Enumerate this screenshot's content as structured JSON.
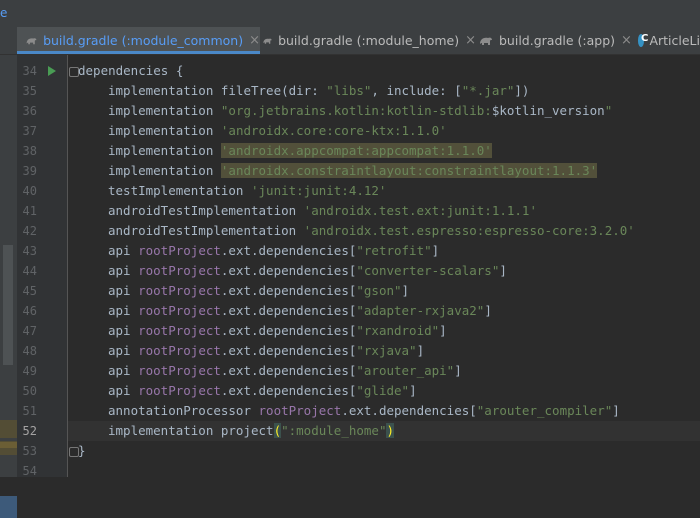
{
  "top_fragment": "e",
  "tabs": [
    {
      "label": "build.gradle (:module_common)",
      "active": true,
      "icon": "gradle-icon"
    },
    {
      "label": "build.gradle (:module_home)",
      "active": false,
      "icon": "gradle-icon"
    },
    {
      "label": "build.gradle (:app)",
      "active": false,
      "icon": "gradle-icon"
    },
    {
      "label": "ArticleLi",
      "active": false,
      "icon": "kotlin-class-icon"
    }
  ],
  "close_glyph": "×",
  "line_numbers": [
    "34",
    "35",
    "36",
    "37",
    "38",
    "39",
    "40",
    "41",
    "42",
    "43",
    "44",
    "45",
    "46",
    "47",
    "48",
    "49",
    "50",
    "51",
    "52",
    "53",
    "54"
  ],
  "code": {
    "l34": "dependencies {",
    "l35_a": "implementation fileTree(dir: ",
    "l35_b": "\"libs\"",
    "l35_c": ", include: [",
    "l35_d": "\"*.jar\"",
    "l35_e": "])",
    "l36_a": "implementation ",
    "l36_b": "\"org.jetbrains.kotlin:kotlin-stdlib:",
    "l36_c": "$kotlin_version",
    "l36_d": "\"",
    "l37_a": "implementation ",
    "l37_b": "'androidx.core:core-ktx:1.1.0'",
    "l38_a": "implementation ",
    "l38_b": "'androidx.appcompat:appcompat:1.1.0'",
    "l39_a": "implementation ",
    "l39_b": "'androidx.constraintlayout:constraintlayout:1.1.3'",
    "l40_a": "testImplementation ",
    "l40_b": "'junit:junit:4.12'",
    "l41_a": "androidTestImplementation ",
    "l41_b": "'androidx.test.ext:junit:1.1.1'",
    "l42_a": "androidTestImplementation ",
    "l42_b": "'androidx.test.espresso:espresso-core:3.2.0'",
    "api": "api ",
    "root": "rootProject",
    "ext_deps": ".ext.dependencies[",
    "close_br": "]",
    "l43": "\"retrofit\"",
    "l44": "\"converter-scalars\"",
    "l45": "\"gson\"",
    "l46": "\"adapter-rxjava2\"",
    "l47": "\"rxandroid\"",
    "l48": "\"rxjava\"",
    "l49": "\"arouter_api\"",
    "l50": "\"glide\"",
    "l51_a": "annotationProcessor ",
    "l51_b": "\"arouter_compiler\"",
    "l52_a": "implementation project",
    "l52_b": "(",
    "l52_c": "\":module_home\"",
    "l52_d": ")",
    "l53": "}"
  },
  "colors": {
    "background": "#2b2b2b",
    "string": "#6a8759",
    "property": "#9876aa",
    "plain": "#a9b7c6",
    "active_tab": "#589df6"
  }
}
